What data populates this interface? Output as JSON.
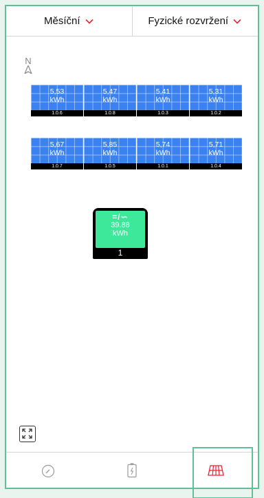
{
  "header": {
    "period_label": "Měsíční",
    "view_label": "Fyzické rozvržení"
  },
  "compass": {
    "label": "N"
  },
  "panels_row1": [
    {
      "value": "5,53",
      "unit": "kWh",
      "id": "1.0.6"
    },
    {
      "value": "5,47",
      "unit": "kWh",
      "id": "1.0.8"
    },
    {
      "value": "5,41",
      "unit": "kWh",
      "id": "1.0.3"
    },
    {
      "value": "5,31",
      "unit": "kWh",
      "id": "1.0.2"
    }
  ],
  "panels_row2": [
    {
      "value": "5,67",
      "unit": "kWh",
      "id": "1.0.7"
    },
    {
      "value": "5,85",
      "unit": "kWh",
      "id": "1.0.5"
    },
    {
      "value": "5,74",
      "unit": "kWh",
      "id": "1.0.1"
    },
    {
      "value": "5,71",
      "unit": "kWh",
      "id": "1.0.4"
    }
  ],
  "inverter": {
    "symbol": "=/∽",
    "value": "39.88",
    "unit": "kWh",
    "number": "1"
  },
  "tabs": [
    {
      "icon": "gauge-icon",
      "active": false
    },
    {
      "icon": "battery-icon",
      "active": false
    },
    {
      "icon": "solar-panel-icon",
      "active": true
    }
  ],
  "colors": {
    "accent": "#e8232f",
    "panel_blue": "#3b82f0",
    "inverter_green": "#3ee89a",
    "highlight": "#5fbf97"
  }
}
